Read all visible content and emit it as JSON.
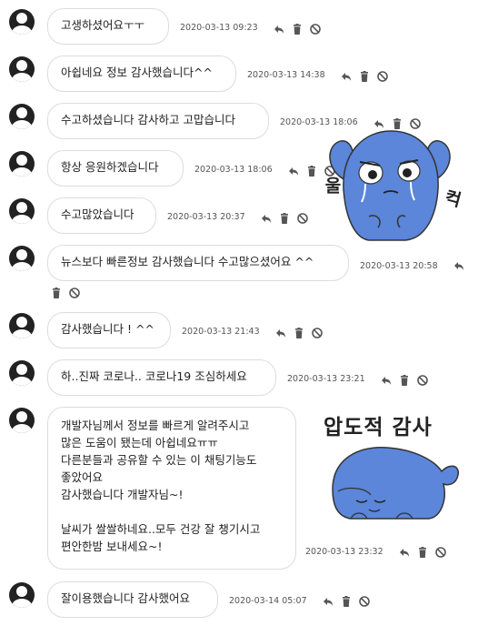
{
  "messages": [
    {
      "text": "고생하셨어요ㅜㅜ",
      "time": "2020-03-13 09:23"
    },
    {
      "text": "아쉽네요 정보 감사했습니다^^",
      "time": "2020-03-13 14:38"
    },
    {
      "text": "수고하셨습니다 감사하고 고맙습니다",
      "time": "2020-03-13 18:06"
    },
    {
      "text": "항상 응원하겠습니다",
      "time": "2020-03-13 18:06"
    },
    {
      "text": "수고많았습니다",
      "time": "2020-03-13 20:37"
    },
    {
      "text": "뉴스보다 빠른정보 감사했습니다 수고많으셨어요 ^^",
      "time": "2020-03-13 20:58"
    },
    {
      "text": "감사했습니다 ! ^^",
      "time": "2020-03-13 21:43"
    },
    {
      "text": "하..진짜 코로나.. 코로나19 조심하세요",
      "time": "2020-03-13 23:21"
    },
    {
      "text": "개발자님께서 정보를 빠르게 알려주시고\n많은 도움이 됐는데 아쉽네요ㅠㅠ\n다른분들과 공유할 수 있는 이 채팅기능도\n좋았어요\n감사했습니다 개발자님~!\n\n날씨가 쌀쌀하네요..모두 건강 잘 챙기시고\n편안한밤 보내세요~!",
      "time": "2020-03-13 23:32"
    },
    {
      "text": "잘이용했습니다 감사했어요",
      "time": "2020-03-14 05:07"
    }
  ],
  "stickers": {
    "sob": {
      "text_left": "울",
      "text_right": "컥"
    },
    "thanks": {
      "text": "압도적 감사"
    }
  },
  "icons": [
    "reply-icon",
    "trash-icon",
    "block-icon"
  ],
  "colors": {
    "sticker_blue": "#5b86d9",
    "bubble_border": "#dcdcdc",
    "icon_gray": "#555555"
  }
}
